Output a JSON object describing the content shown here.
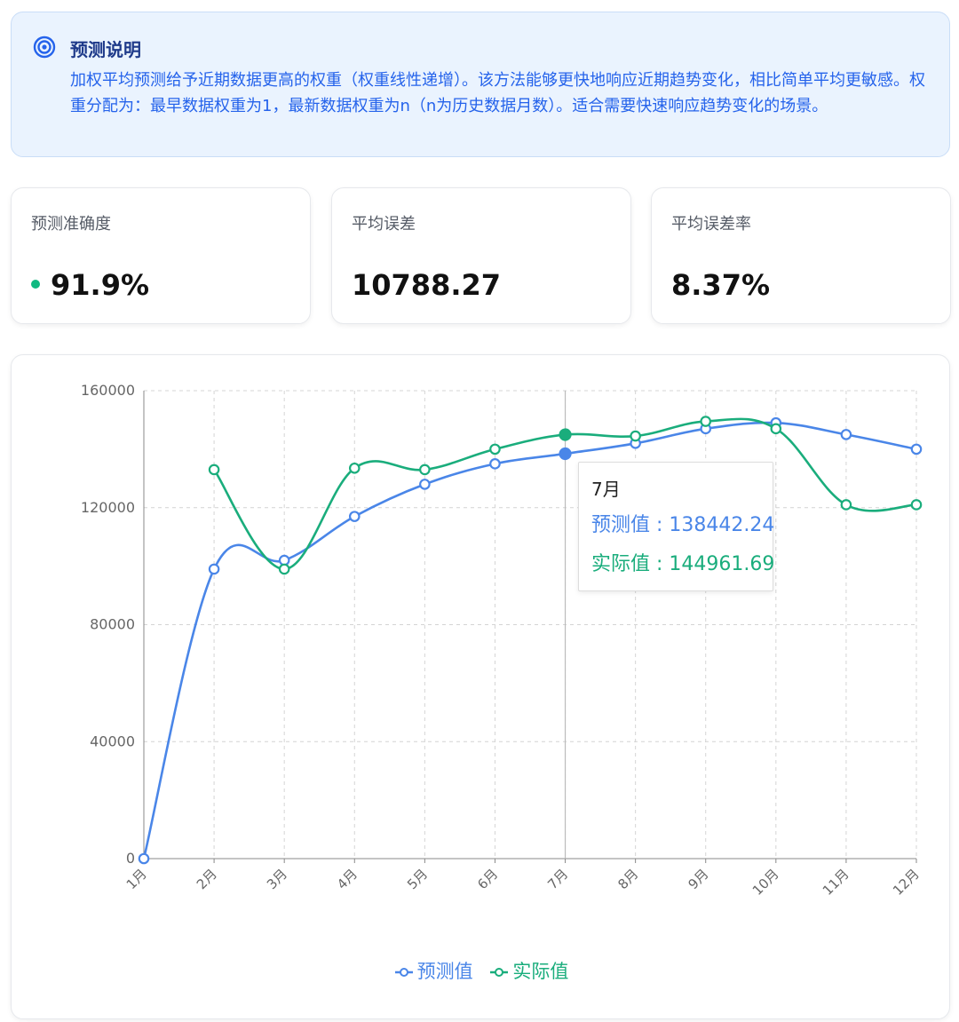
{
  "info": {
    "icon": "target-icon",
    "title": "预测说明",
    "text": "加权平均预测给予近期数据更高的权重（权重线性递增）。该方法能够更快地响应近期趋势变化，相比简单平均更敏感。权重分配为：最早数据权重为1，最新数据权重为n（n为历史数据月数）。适合需要快速响应趋势变化的场景。"
  },
  "metrics": [
    {
      "label": "预测准确度",
      "value": "91.9%",
      "status_color": "#10b981"
    },
    {
      "label": "平均误差",
      "value": "10788.27"
    },
    {
      "label": "平均误差率",
      "value": "8.37%"
    }
  ],
  "chart_data": {
    "type": "line",
    "categories": [
      "1月",
      "2月",
      "3月",
      "4月",
      "5月",
      "6月",
      "7月",
      "8月",
      "9月",
      "10月",
      "11月",
      "12月"
    ],
    "series": [
      {
        "name": "预测值",
        "color": "#4a86e8",
        "values": [
          0,
          99000,
          102000,
          117000,
          128000,
          135000,
          138442.24,
          142000,
          147000,
          149000,
          145000,
          140000
        ]
      },
      {
        "name": "实际值",
        "color": "#1aad7c",
        "values": [
          null,
          133000,
          99000,
          133500,
          133000,
          140000,
          144961.69,
          144500,
          149500,
          147000,
          121000,
          121000
        ]
      }
    ],
    "yticks": [
      "0",
      "40000",
      "80000",
      "120000",
      "160000"
    ],
    "ylim": [
      0,
      160000
    ],
    "grid": true,
    "legend_position": "bottom",
    "highlight_index": 6,
    "tooltip": {
      "title": "7月",
      "rows": [
        {
          "label": "预测值 : 138442.24"
        },
        {
          "label": "实际值 : 144961.69"
        }
      ]
    }
  }
}
